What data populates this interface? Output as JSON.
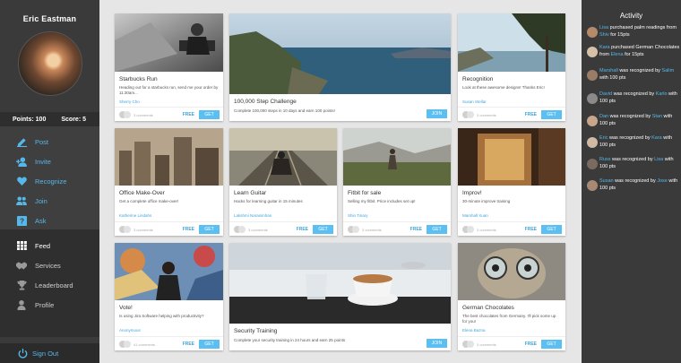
{
  "user": {
    "name": "Eric Eastman",
    "points": "Points: 100",
    "score": "Score: 5"
  },
  "nav": [
    {
      "label": "Post",
      "icon": "edit-icon"
    },
    {
      "label": "Invite",
      "icon": "add-user-icon"
    },
    {
      "label": "Recognize",
      "icon": "heart-icon"
    },
    {
      "label": "Join",
      "icon": "users-icon"
    },
    {
      "label": "Ask",
      "icon": "question-icon"
    }
  ],
  "nav2": [
    {
      "label": "Feed",
      "icon": "grid-icon"
    },
    {
      "label": "Services",
      "icon": "handshake-icon"
    },
    {
      "label": "Leaderboard",
      "icon": "trophy-icon"
    },
    {
      "label": "Profile",
      "icon": "person-icon"
    }
  ],
  "signout": "Sign Out",
  "cards": [
    {
      "title": "Starbucks Run",
      "desc": "Heading out for a starbucks run, send me your order by 11:30am...",
      "author": "Sherry Cho",
      "comments": "3 comments",
      "free": "FREE",
      "btn": "GET"
    },
    {
      "title": "100,000 Step Challenge",
      "desc": "Complete 100,000 steps in 10 days and earn 100 points!",
      "author": "",
      "comments": "",
      "free": "",
      "btn": "JOIN"
    },
    {
      "title": "Recognition",
      "desc": "Look at these awesome designs! Thanks Eric!",
      "author": "Susan Stellar",
      "comments": "3 comments",
      "free": "FREE",
      "btn": "GET"
    },
    {
      "title": "Office Make-Over",
      "desc": "Get a complete office make-over!",
      "author": "Katherine Lindahs",
      "comments": "3 comments",
      "free": "FREE",
      "btn": "GET"
    },
    {
      "title": "Learn Guitar",
      "desc": "Hacks for learning guitar in 15 minutes",
      "author": "Lakshmi Narasimhan",
      "comments": "3 comments",
      "free": "FREE",
      "btn": "GET"
    },
    {
      "title": "Fitbit for sale",
      "desc": "Selling my fitbit. Price includes set up!",
      "author": "Shin Tinary",
      "comments": "3 comments",
      "free": "FREE",
      "btn": "GET"
    },
    {
      "title": "Improv!",
      "desc": "30-minute improve training",
      "author": "Marshall Xuan",
      "comments": "3 comments",
      "free": "FREE",
      "btn": "GET"
    },
    {
      "title": "Vote!",
      "desc": "Is using Jira Software helping with productivity?",
      "author": "Anonymous",
      "comments": "41 comments",
      "free": "FREE",
      "btn": "GET"
    },
    {
      "title": "Security Training",
      "desc": "Complete your security training in 24 hours and earn 25 points",
      "author": "",
      "comments": "",
      "free": "",
      "btn": "JOIN"
    },
    {
      "title": "German Chocolates",
      "desc": "The best chocolates from Germany. I'll pick some up for you!",
      "author": "Elena Bazna",
      "comments": "3 comments",
      "free": "FREE",
      "btn": "GET"
    }
  ],
  "activity": {
    "title": "Activity",
    "items": [
      {
        "a": "Lisa",
        "mid": " purchased palm readings from ",
        "b": "Shiv",
        "end": " for 15pts",
        "color": "#b58a6a"
      },
      {
        "a": "Kara",
        "mid": " purchased German Chocolates from ",
        "b": "Elena",
        "end": " for 15pts",
        "color": "#d6c1a8"
      },
      {
        "a": "Marshall",
        "mid": " was recognized by ",
        "b": "Salim",
        "end": " with 100 pts",
        "color": "#9a7d66"
      },
      {
        "a": "David",
        "mid": " was recognized by ",
        "b": "Karlo",
        "end": " with 100 pts",
        "color": "#8a8a8a"
      },
      {
        "a": "Dan",
        "mid": " was recognized by ",
        "b": "Stan",
        "end": " with 100 pts",
        "color": "#c7a68b"
      },
      {
        "a": "Eric",
        "mid": " was recognized by ",
        "b": "Kara",
        "end": " with 100 pts",
        "color": "#d1b9a4"
      },
      {
        "a": "Russ",
        "mid": " was recognized by ",
        "b": "Lisa",
        "end": " with 100 pts",
        "color": "#7a6a60"
      },
      {
        "a": "Susan",
        "mid": " was recognized by ",
        "b": "Jose",
        "end": " with 100 pts",
        "color": "#a88a74"
      }
    ]
  }
}
